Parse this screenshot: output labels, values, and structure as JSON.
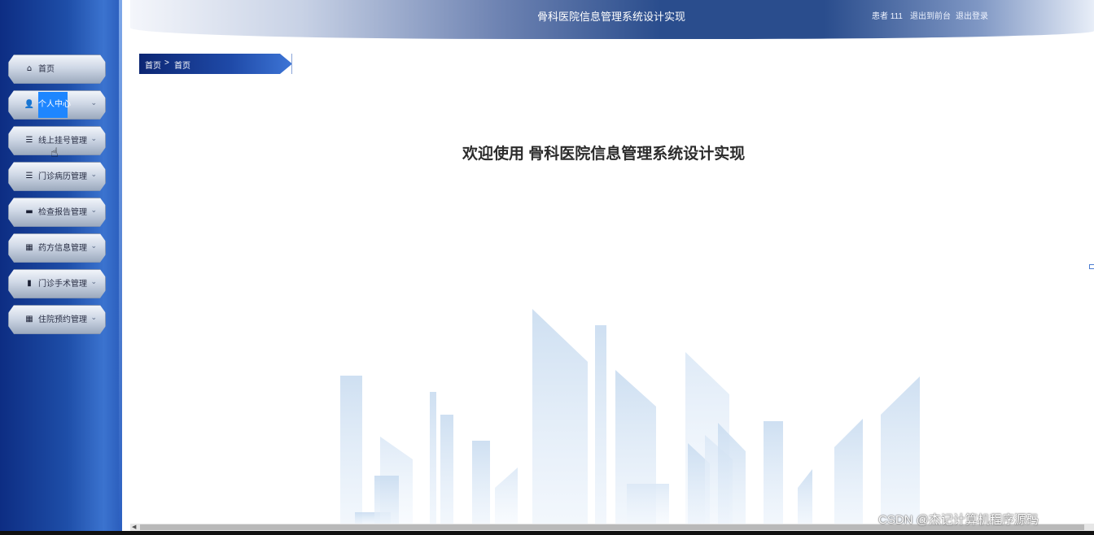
{
  "header": {
    "title": "骨科医院信息管理系统设计实现",
    "user": "患者 111",
    "back_to_home": "退出到前台",
    "logout": "退出登录"
  },
  "sidebar": {
    "items": [
      {
        "label": "首页",
        "icon": "home-icon"
      },
      {
        "label": "个人中心",
        "icon": "user-icon"
      },
      {
        "label": "线上挂号管理",
        "icon": "list-icon"
      },
      {
        "label": "门诊病历管理",
        "icon": "list-icon"
      },
      {
        "label": "检查报告管理",
        "icon": "monitor-icon"
      },
      {
        "label": "药方信息管理",
        "icon": "grid-icon"
      },
      {
        "label": "门诊手术管理",
        "icon": "bar-chart-icon"
      },
      {
        "label": "住院预约管理",
        "icon": "grid-icon"
      }
    ]
  },
  "breadcrumb": {
    "home": "首页",
    "separator": ">",
    "current": "首页"
  },
  "main": {
    "welcome": "欢迎使用 骨科医院信息管理系统设计实现"
  },
  "watermark": "CSDN @杰记计算机程序源码",
  "colors": {
    "sidebar_bg": "#1e4ea8",
    "active_item": "#1e86ff",
    "breadcrumb_bg": "#1f4aa8",
    "header_dark": "#2a4d8d"
  }
}
